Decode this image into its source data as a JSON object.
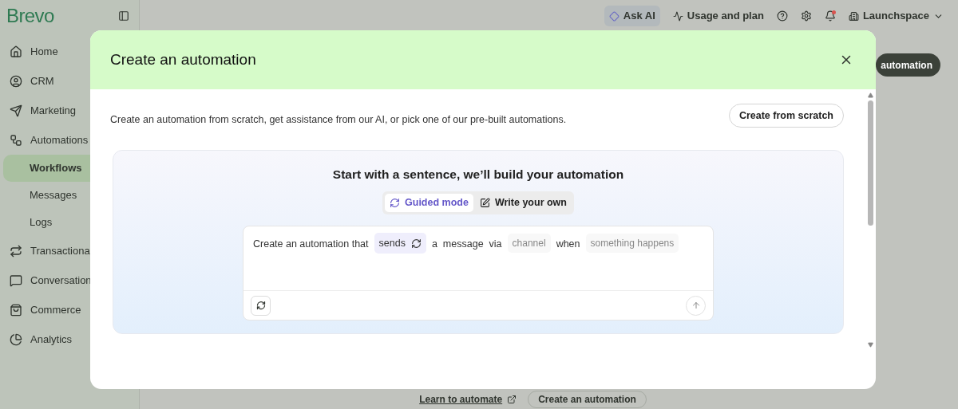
{
  "sidebar": {
    "logo": "Brevo",
    "items": [
      {
        "label": "Home",
        "selected": false
      },
      {
        "label": "CRM",
        "selected": false
      },
      {
        "label": "Marketing",
        "selected": false
      },
      {
        "label": "Automations",
        "selected": false,
        "children": [
          {
            "label": "Workflows",
            "selected": true
          },
          {
            "label": "Messages",
            "selected": false
          },
          {
            "label": "Logs",
            "selected": false
          }
        ]
      },
      {
        "label": "Transactiona",
        "selected": false
      },
      {
        "label": "Conversation",
        "selected": false
      },
      {
        "label": "Commerce",
        "selected": false
      },
      {
        "label": "Analytics",
        "selected": false
      }
    ]
  },
  "topbar": {
    "ask_ai": "Ask AI",
    "usage": "Usage and plan",
    "account": "Launchspace"
  },
  "background": {
    "header_button": "automation",
    "learn_link": "Learn to automate",
    "create_button": "Create an automation"
  },
  "modal": {
    "title": "Create an automation",
    "description": "Create an automation from scratch, get assistance from our AI, or pick one of our pre-built automations.",
    "scratch_button": "Create from scratch",
    "card": {
      "heading": "Start with a sentence, we’ll build your automation",
      "modes": [
        {
          "label": "Guided mode",
          "selected": true
        },
        {
          "label": "Write your own",
          "selected": false
        }
      ],
      "sentence": [
        {
          "kind": "text",
          "text": "Create an automation that"
        },
        {
          "kind": "chip",
          "text": "sends"
        },
        {
          "kind": "text",
          "text": "a"
        },
        {
          "kind": "text",
          "text": "message"
        },
        {
          "kind": "text",
          "text": "via"
        },
        {
          "kind": "placeholder",
          "text": "channel"
        },
        {
          "kind": "text",
          "text": "when"
        },
        {
          "kind": "placeholder",
          "text": "something happens"
        }
      ]
    }
  }
}
